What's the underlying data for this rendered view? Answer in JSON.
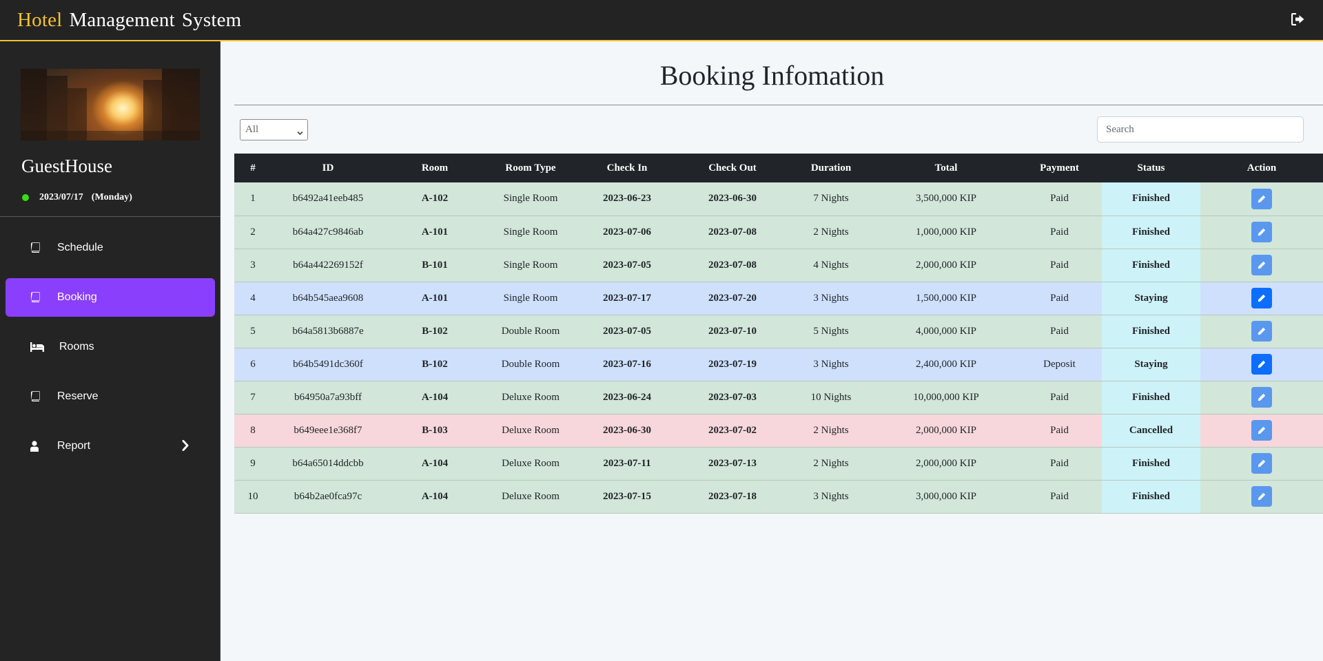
{
  "header": {
    "brand_highlight": "Hotel",
    "brand_word2": "Management",
    "brand_word3": "System",
    "accent_color": "#f7c12f",
    "logout_icon": "sign-out-icon"
  },
  "sidebar": {
    "hero_image": "city-sunset-image",
    "property_name": "GuestHouse",
    "date": "2023/07/17",
    "weekday": "(Monday)",
    "status_dot_color": "#36e012",
    "active_color": "#8a3ffc",
    "items": [
      {
        "label": "Schedule",
        "icon": "book-icon"
      },
      {
        "label": "Booking",
        "icon": "book-icon",
        "active": true
      },
      {
        "label": "Rooms",
        "icon": "bed-icon"
      },
      {
        "label": "Reserve",
        "icon": "book-icon"
      },
      {
        "label": "Report",
        "icon": "user-icon",
        "expandable": true
      }
    ]
  },
  "main": {
    "title": "Booking Infomation",
    "filter": {
      "selected": "All"
    },
    "search": {
      "placeholder": "Search",
      "value": ""
    },
    "table": {
      "columns": [
        "#",
        "ID",
        "Room",
        "Room Type",
        "Check In",
        "Check Out",
        "Duration",
        "Total",
        "Payment",
        "Status",
        "Action"
      ],
      "rows": [
        {
          "no": "1",
          "id": "b6492a41eeb485",
          "room": "A-102",
          "type": "Single Room",
          "check_in": "2023-06-23",
          "check_out": "2023-06-30",
          "duration": "7 Nights",
          "total": "3,500,000 KIP",
          "payment": "Paid",
          "status": "Finished"
        },
        {
          "no": "2",
          "id": "b64a427c9846ab",
          "room": "A-101",
          "type": "Single Room",
          "check_in": "2023-07-06",
          "check_out": "2023-07-08",
          "duration": "2 Nights",
          "total": "1,000,000 KIP",
          "payment": "Paid",
          "status": "Finished"
        },
        {
          "no": "3",
          "id": "b64a442269152f",
          "room": "B-101",
          "type": "Single Room",
          "check_in": "2023-07-05",
          "check_out": "2023-07-08",
          "duration": "4 Nights",
          "total": "2,000,000 KIP",
          "payment": "Paid",
          "status": "Finished"
        },
        {
          "no": "4",
          "id": "b64b545aea9608",
          "room": "A-101",
          "type": "Single Room",
          "check_in": "2023-07-17",
          "check_out": "2023-07-20",
          "duration": "3 Nights",
          "total": "1,500,000 KIP",
          "payment": "Paid",
          "status": "Staying"
        },
        {
          "no": "5",
          "id": "b64a5813b6887e",
          "room": "B-102",
          "type": "Double Room",
          "check_in": "2023-07-05",
          "check_out": "2023-07-10",
          "duration": "5 Nights",
          "total": "4,000,000 KIP",
          "payment": "Paid",
          "status": "Finished"
        },
        {
          "no": "6",
          "id": "b64b5491dc360f",
          "room": "B-102",
          "type": "Double Room",
          "check_in": "2023-07-16",
          "check_out": "2023-07-19",
          "duration": "3 Nights",
          "total": "2,400,000 KIP",
          "payment": "Deposit",
          "status": "Staying"
        },
        {
          "no": "7",
          "id": "b64950a7a93bff",
          "room": "A-104",
          "type": "Deluxe Room",
          "check_in": "2023-06-24",
          "check_out": "2023-07-03",
          "duration": "10 Nights",
          "total": "10,000,000 KIP",
          "payment": "Paid",
          "status": "Finished"
        },
        {
          "no": "8",
          "id": "b649eee1e368f7",
          "room": "B-103",
          "type": "Deluxe Room",
          "check_in": "2023-06-30",
          "check_out": "2023-07-02",
          "duration": "2 Nights",
          "total": "2,000,000 KIP",
          "payment": "Paid",
          "status": "Cancelled"
        },
        {
          "no": "9",
          "id": "b64a65014ddcbb",
          "room": "A-104",
          "type": "Deluxe Room",
          "check_in": "2023-07-11",
          "check_out": "2023-07-13",
          "duration": "2 Nights",
          "total": "2,000,000 KIP",
          "payment": "Paid",
          "status": "Finished"
        },
        {
          "no": "10",
          "id": "b64b2ae0fca97c",
          "room": "A-104",
          "type": "Deluxe Room",
          "check_in": "2023-07-15",
          "check_out": "2023-07-18",
          "duration": "3 Nights",
          "total": "3,000,000 KIP",
          "payment": "Paid",
          "status": "Finished"
        }
      ],
      "row_colors": {
        "Finished": "#d2e6da",
        "Staying": "#cfe0fd",
        "Cancelled": "#f7d7db"
      },
      "action_icon": "pencil-icon"
    }
  }
}
